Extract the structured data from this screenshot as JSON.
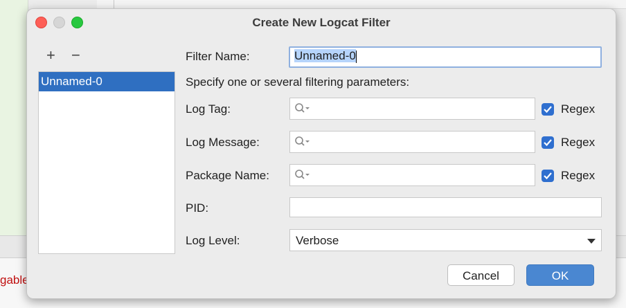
{
  "background": {
    "left_text": "gable"
  },
  "dialog": {
    "title": "Create New Logcat Filter",
    "list_toolbar": {
      "add_label": "+",
      "remove_label": "−"
    },
    "filters": [
      "Unnamed-0"
    ],
    "form": {
      "filter_name_label": "Filter Name:",
      "filter_name_value": "Unnamed-0",
      "instructions": "Specify one or several filtering parameters:",
      "log_tag_label": "Log Tag:",
      "log_message_label": "Log Message:",
      "package_name_label": "Package Name:",
      "regex_label": "Regex",
      "regex_checked": [
        true,
        true,
        true
      ],
      "pid_label": "PID:",
      "pid_value": "",
      "log_level_label": "Log Level:",
      "log_level_value": "Verbose"
    },
    "buttons": {
      "cancel": "Cancel",
      "ok": "OK"
    }
  },
  "colors": {
    "accent": "#2f6fc1",
    "ok_button": "#4a87d1",
    "checkbox": "#2f6fcf",
    "close": "#fe5f57",
    "maximize": "#28c840"
  },
  "icons": [
    "search-icon",
    "checkmark-icon",
    "chevron-down-icon"
  ]
}
